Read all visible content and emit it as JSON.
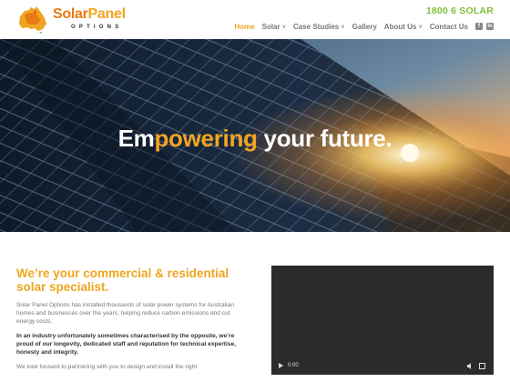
{
  "brand": {
    "name_part1": "Solar",
    "name_part2": "Panel",
    "subtitle": "OPTIONS"
  },
  "header": {
    "phone": "1800 6 SOLAR"
  },
  "nav": {
    "items": [
      {
        "label": "Home",
        "active": true,
        "dropdown": false
      },
      {
        "label": "Solar",
        "active": false,
        "dropdown": true
      },
      {
        "label": "Case Studies",
        "active": false,
        "dropdown": true
      },
      {
        "label": "Gallery",
        "active": false,
        "dropdown": false
      },
      {
        "label": "About Us",
        "active": false,
        "dropdown": true
      },
      {
        "label": "Contact Us",
        "active": false,
        "dropdown": false
      }
    ],
    "social": [
      {
        "icon": "facebook-icon",
        "glyph": "f"
      },
      {
        "icon": "linkedin-icon",
        "glyph": "in"
      }
    ]
  },
  "hero": {
    "title_part1": "Em",
    "title_accent": "powering",
    "title_part2": " your future."
  },
  "intro": {
    "heading": "We’re your commercial & residential solar specialist.",
    "para1": "Solar Panel Options has installed thousands of solar power systems for Australian homes and businesses over the years, helping reduce carbon emissions and cut energy costs.",
    "para2": "In an industry unfortunately sometimes characterised by the opposite, we’re proud of our longevity, dedicated staff and reputation for technical expertise, honesty and integrity.",
    "para3": "We look forward to partnering with you to design and install the right"
  },
  "video": {
    "time": "0:00"
  },
  "colors": {
    "accent": "#f0a51f",
    "phone": "#7cbf3a",
    "orange": "#e87b14"
  }
}
